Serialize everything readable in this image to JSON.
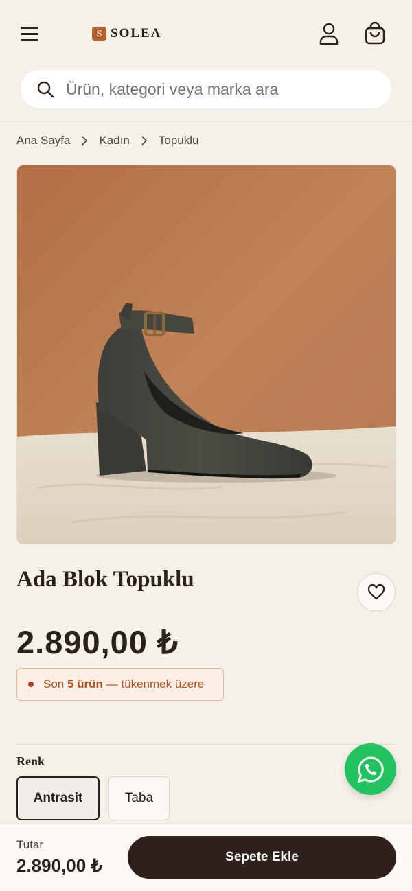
{
  "brand": {
    "logo_letter": "S",
    "name": "SOLEA",
    "accent": "#b4632f"
  },
  "search": {
    "placeholder": "Ürün, kategori veya marka ara"
  },
  "breadcrumb": [
    "Ana Sayfa",
    "Kadın",
    "Topuklu"
  ],
  "product": {
    "title": "Ada Blok Topuklu",
    "price": "2.890,00 ₺",
    "stock": {
      "prefix": "Son",
      "count": "5 ürün",
      "suffix": "— tükenmek üzere"
    },
    "image_alt": "Antrasit süet blok topuklu ayakkabı"
  },
  "color": {
    "label": "Renk",
    "options": [
      {
        "label": "Antrasit",
        "selected": true
      },
      {
        "label": "Taba",
        "selected": false
      }
    ]
  },
  "bottom_bar": {
    "total_label": "Tutar",
    "total_value": "2.890,00 ₺",
    "cta": "Sepete Ekle"
  },
  "icons": [
    "menu-icon",
    "user-icon",
    "cart-icon",
    "search-icon",
    "chevron-right-icon",
    "heart-icon",
    "whatsapp-icon"
  ],
  "colors": {
    "background": "#f6f0ea",
    "dark": "#2b211c",
    "cta": "#2e201b",
    "whatsapp": "#22c35e",
    "stock_text": "#b0511c"
  }
}
